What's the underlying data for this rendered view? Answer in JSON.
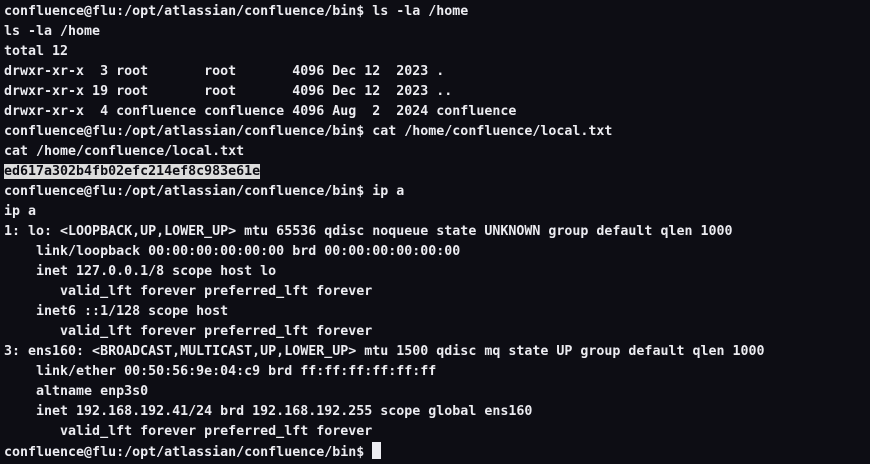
{
  "terminal": {
    "colors": {
      "background": "#0d0d14",
      "foreground": "#ececf1",
      "selection_background": "#dcdcdc"
    },
    "lines": [
      "confluence@flu:/opt/atlassian/confluence/bin$ ls -la /home",
      "ls -la /home",
      "total 12",
      "drwxr-xr-x  3 root       root       4096 Dec 12  2023 .",
      "drwxr-xr-x 19 root       root       4096 Dec 12  2023 ..",
      "drwxr-xr-x  4 confluence confluence 4096 Aug  2  2024 confluence",
      "confluence@flu:/opt/atlassian/confluence/bin$ cat /home/confluence/local.txt",
      "cat /home/confluence/local.txt",
      "ed617a302b4fb02efc214ef8c983e61e",
      "confluence@flu:/opt/atlassian/confluence/bin$ ip a",
      "ip a",
      "1: lo: <LOOPBACK,UP,LOWER_UP> mtu 65536 qdisc noqueue state UNKNOWN group default qlen 1000",
      "    link/loopback 00:00:00:00:00:00 brd 00:00:00:00:00:00",
      "    inet 127.0.0.1/8 scope host lo",
      "       valid_lft forever preferred_lft forever",
      "    inet6 ::1/128 scope host",
      "       valid_lft forever preferred_lft forever",
      "3: ens160: <BROADCAST,MULTICAST,UP,LOWER_UP> mtu 1500 qdisc mq state UP group default qlen 1000",
      "    link/ether 00:50:56:9e:04:c9 brd ff:ff:ff:ff:ff:ff",
      "    altname enp3s0",
      "    inet 192.168.192.41/24 brd 192.168.192.255 scope global ens160",
      "       valid_lft forever preferred_lft forever"
    ],
    "prompt": "confluence@flu:/opt/atlassian/confluence/bin$ "
  }
}
